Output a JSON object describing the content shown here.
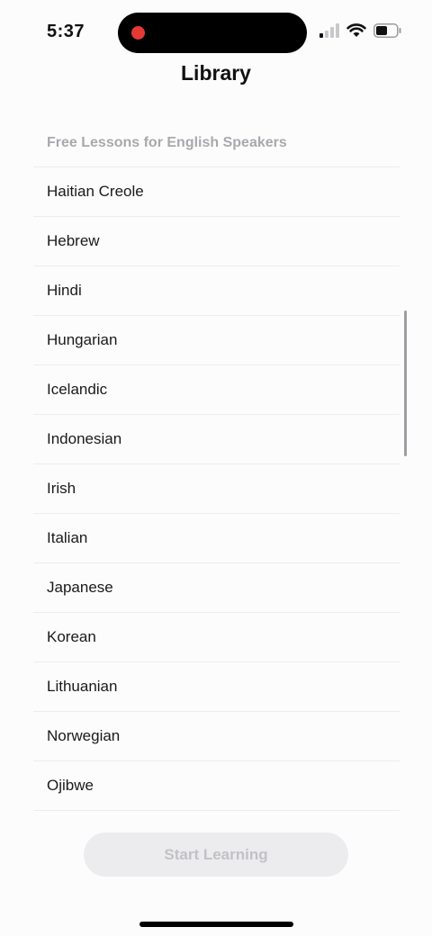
{
  "status_bar": {
    "time": "5:37",
    "recording_color": "#e53935",
    "icons": [
      "signal-icon",
      "wifi-icon",
      "battery-icon"
    ],
    "battery_level": 0.5
  },
  "header": {
    "title": "Library"
  },
  "section": {
    "title": "Free Lessons for English Speakers"
  },
  "languages": [
    "Haitian Creole",
    "Hebrew",
    "Hindi",
    "Hungarian",
    "Icelandic",
    "Indonesian",
    "Irish",
    "Italian",
    "Japanese",
    "Korean",
    "Lithuanian",
    "Norwegian",
    "Ojibwe"
  ],
  "footer": {
    "start_label": "Start Learning",
    "start_enabled": false
  },
  "colors": {
    "background": "#fdfcfd",
    "separator": "#ececee",
    "section_header": "#a9a9ad",
    "button_disabled_bg": "#ececee",
    "button_disabled_text": "#c2c2c6"
  }
}
